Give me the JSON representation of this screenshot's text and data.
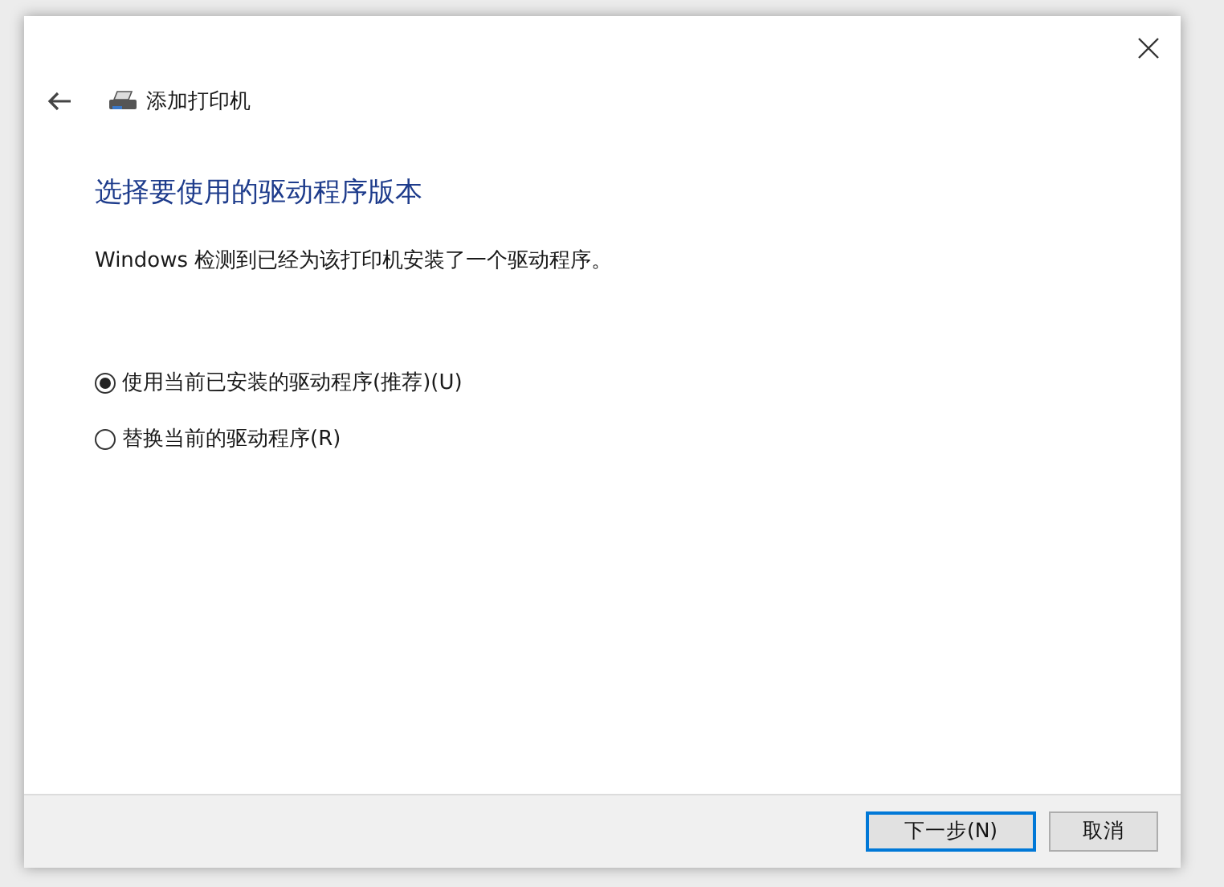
{
  "window": {
    "title": "添加打印机"
  },
  "heading": "选择要使用的驱动程序版本",
  "description": "Windows 检测到已经为该打印机安装了一个驱动程序。",
  "options": [
    {
      "label": "使用当前已安装的驱动程序(推荐)(U)",
      "selected": true
    },
    {
      "label": "替换当前的驱动程序(R)",
      "selected": false
    }
  ],
  "buttons": [
    {
      "label": "下一步(N)",
      "kind": "default"
    },
    {
      "label": "取消",
      "kind": "normal"
    }
  ]
}
